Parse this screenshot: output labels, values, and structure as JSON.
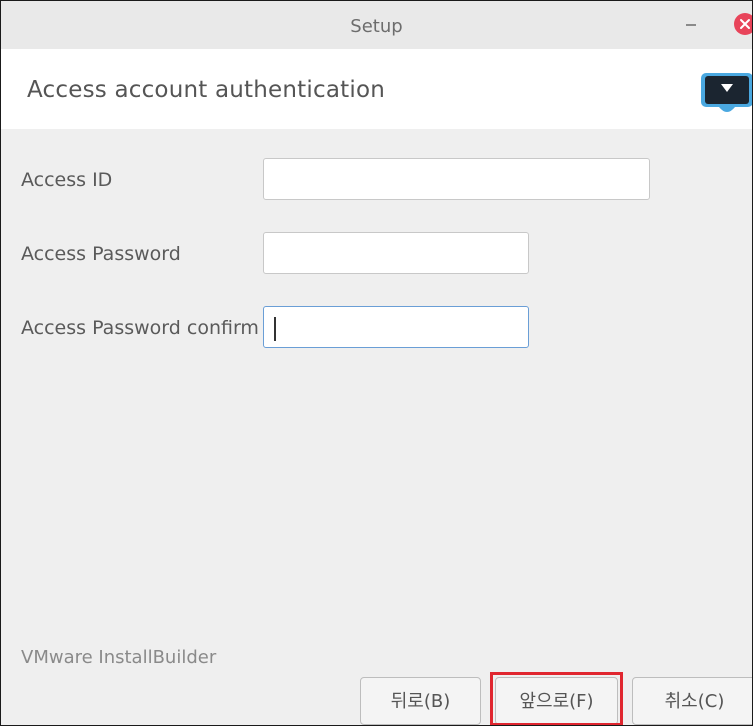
{
  "window": {
    "title": "Setup"
  },
  "header": {
    "title": "Access account authentication",
    "logo_icon": "installer-monitor-icon"
  },
  "form": {
    "fields": [
      {
        "label": "Access ID",
        "value": "",
        "placeholder": ""
      },
      {
        "label": "Access Password",
        "value": "",
        "placeholder": ""
      },
      {
        "label": "Access Password confirm",
        "value": "",
        "placeholder": ""
      }
    ]
  },
  "footer": {
    "brand": "VMware InstallBuilder"
  },
  "buttons": {
    "back": "뒤로(B)",
    "next": "앞으로(F)",
    "cancel": "취소(C)"
  },
  "colors": {
    "close": "#e8445a",
    "highlight": "#e0262f",
    "focus_border": "#6a9ed6",
    "logo_accent": "#4aa8e0"
  }
}
